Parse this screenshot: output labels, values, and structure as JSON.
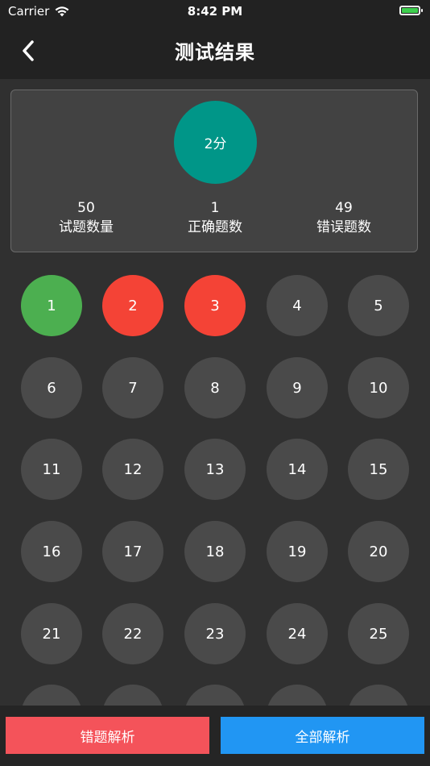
{
  "status_bar": {
    "carrier": "Carrier",
    "time": "8:42 PM"
  },
  "nav": {
    "title": "测试结果"
  },
  "summary": {
    "score": "2分",
    "stats": [
      {
        "value": "50",
        "label": "试题数量"
      },
      {
        "value": "1",
        "label": "正确题数"
      },
      {
        "value": "49",
        "label": "错误题数"
      }
    ]
  },
  "colors": {
    "correct": "#4caf50",
    "wrong": "#f44336",
    "unanswered": "#4a4a4a",
    "score": "#009688"
  },
  "questions": [
    {
      "n": "1",
      "state": "correct"
    },
    {
      "n": "2",
      "state": "wrong"
    },
    {
      "n": "3",
      "state": "wrong"
    },
    {
      "n": "4",
      "state": "unanswered"
    },
    {
      "n": "5",
      "state": "unanswered"
    },
    {
      "n": "6",
      "state": "unanswered"
    },
    {
      "n": "7",
      "state": "unanswered"
    },
    {
      "n": "8",
      "state": "unanswered"
    },
    {
      "n": "9",
      "state": "unanswered"
    },
    {
      "n": "10",
      "state": "unanswered"
    },
    {
      "n": "11",
      "state": "unanswered"
    },
    {
      "n": "12",
      "state": "unanswered"
    },
    {
      "n": "13",
      "state": "unanswered"
    },
    {
      "n": "14",
      "state": "unanswered"
    },
    {
      "n": "15",
      "state": "unanswered"
    },
    {
      "n": "16",
      "state": "unanswered"
    },
    {
      "n": "17",
      "state": "unanswered"
    },
    {
      "n": "18",
      "state": "unanswered"
    },
    {
      "n": "19",
      "state": "unanswered"
    },
    {
      "n": "20",
      "state": "unanswered"
    },
    {
      "n": "21",
      "state": "unanswered"
    },
    {
      "n": "22",
      "state": "unanswered"
    },
    {
      "n": "23",
      "state": "unanswered"
    },
    {
      "n": "24",
      "state": "unanswered"
    },
    {
      "n": "25",
      "state": "unanswered"
    },
    {
      "n": "",
      "state": "unanswered"
    },
    {
      "n": "",
      "state": "unanswered"
    },
    {
      "n": "",
      "state": "unanswered"
    },
    {
      "n": "",
      "state": "unanswered"
    },
    {
      "n": "",
      "state": "unanswered"
    }
  ],
  "buttons": {
    "wrong_analysis": "错题解析",
    "all_analysis": "全部解析"
  }
}
